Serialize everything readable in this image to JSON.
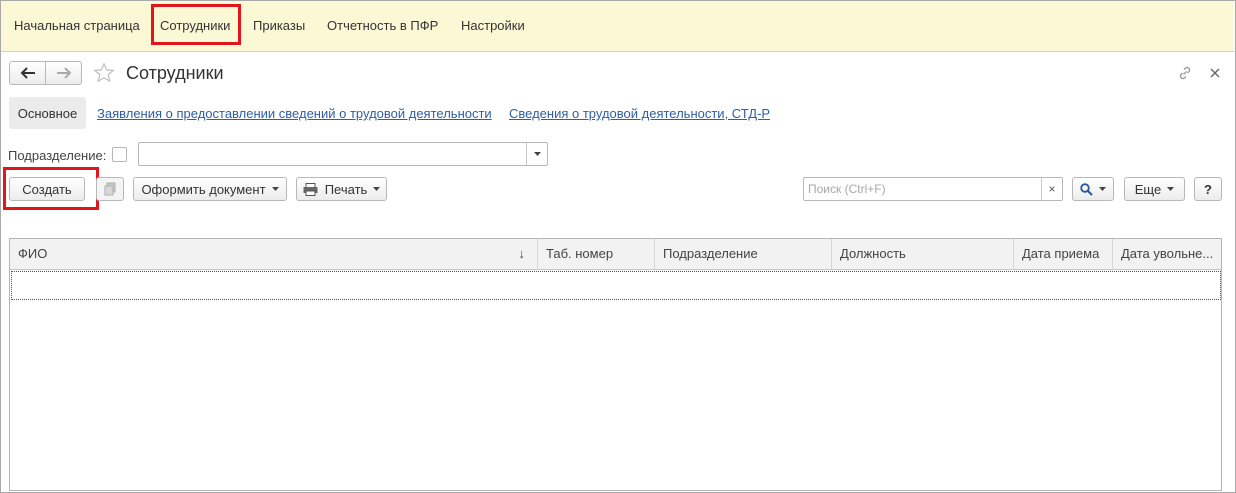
{
  "topnav": {
    "items": [
      "Начальная страница",
      "Сотрудники",
      "Приказы",
      "Отчетность в ПФР",
      "Настройки"
    ],
    "active": "Сотрудники"
  },
  "header": {
    "title": "Сотрудники",
    "back_icon": "arrow-left-icon",
    "forward_icon": "arrow-right-icon",
    "favorite_icon": "star-icon",
    "link_icon": "link-icon",
    "close_icon": "close-icon"
  },
  "tabs": {
    "main": "Основное",
    "link1": "Заявления о предоставлении сведений о трудовой деятельности",
    "link2": "Сведения о трудовой деятельности, СТД-Р"
  },
  "filter": {
    "label": "Подразделение:",
    "value": ""
  },
  "toolbar": {
    "create": "Создать",
    "issue_doc": "Оформить документ",
    "print": "Печать",
    "search_placeholder": "Поиск (Ctrl+F)",
    "clear_glyph": "×",
    "more": "Еще",
    "help": "?"
  },
  "table": {
    "columns": [
      "ФИО",
      "Таб. номер",
      "Подразделение",
      "Должность",
      "Дата приема",
      "Дата увольне..."
    ],
    "sort_indicator": "↓",
    "rows": []
  },
  "colors": {
    "topnav_bg": "#fbf8d6",
    "highlight": "#e0161b",
    "link": "#2d5ea6"
  }
}
